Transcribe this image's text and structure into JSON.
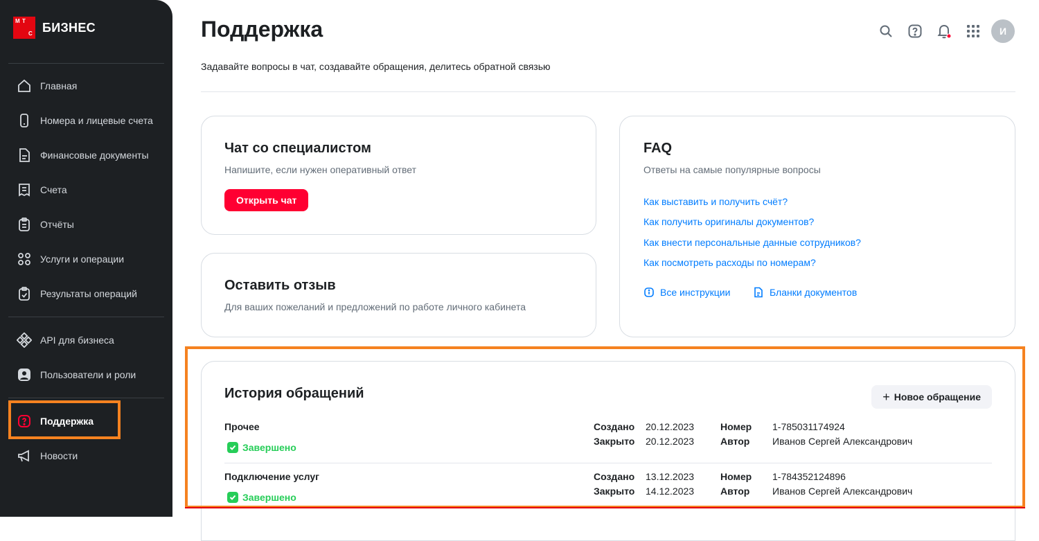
{
  "brand": {
    "logo_letters": [
      "М",
      "Т",
      "С"
    ],
    "name": "БИЗНЕС",
    "color": "#e30611"
  },
  "sidebar": {
    "items": [
      {
        "label": "Главная",
        "icon": "home-icon"
      },
      {
        "label": "Номера и лицевые счета",
        "icon": "phone-icon"
      },
      {
        "label": "Финансовые документы",
        "icon": "document-icon"
      },
      {
        "label": "Счета",
        "icon": "receipt-icon"
      },
      {
        "label": "Отчёты",
        "icon": "clipboard-icon"
      },
      {
        "label": "Услуги и операции",
        "icon": "grid-icon"
      },
      {
        "label": "Результаты операций",
        "icon": "clipboard-check-icon"
      },
      {
        "label": "API для бизнеса",
        "icon": "api-icon"
      },
      {
        "label": "Пользователи и роли",
        "icon": "user-badge-icon"
      },
      {
        "label": "Поддержка",
        "icon": "support-icon",
        "active": true
      },
      {
        "label": "Новости",
        "icon": "megaphone-icon"
      }
    ]
  },
  "header": {
    "title": "Поддержка",
    "subtitle": "Задавайте вопросы в чат, создавайте обращения, делитесь обратной связью",
    "avatar_letter": "И",
    "icons": [
      "search-icon",
      "help-icon",
      "bell-icon",
      "apps-icon"
    ]
  },
  "chat_card": {
    "title": "Чат со специалистом",
    "subtitle": "Напишите, если нужен оперативный ответ",
    "button": "Открыть чат"
  },
  "feedback_card": {
    "title": "Оставить отзыв",
    "subtitle": "Для ваших пожеланий и предложений по работе личного кабинета"
  },
  "faq_card": {
    "title": "FAQ",
    "subtitle": "Ответы на самые популярные вопросы",
    "links": [
      "Как выставить и получить счёт?",
      "Как получить оригиналы документов?",
      "Как внести персональные данные сотрудников?",
      "Как посмотреть расходы по номерам?"
    ],
    "all_instructions": "Все инструкции",
    "doc_forms": "Бланки документов"
  },
  "history": {
    "title": "История обращений",
    "new_button": "Новое обращение",
    "labels": {
      "created": "Создано",
      "closed": "Закрыто",
      "number": "Номер",
      "author": "Автор"
    },
    "rows": [
      {
        "title": "Прочее",
        "status": "Завершено",
        "created": "20.12.2023",
        "closed": "20.12.2023",
        "number": "1-785031174924",
        "author": "Иванов Сергей Александрович"
      },
      {
        "title": "Подключение услуг",
        "status": "Завершено",
        "created": "13.12.2023",
        "closed": "14.12.2023",
        "number": "1-784352124896",
        "author": "Иванов Сергей Александрович"
      }
    ]
  },
  "colors": {
    "accent_red": "#ff0032",
    "link_blue": "#007cff",
    "success_green": "#26cd58",
    "highlight_orange": "#f58220"
  }
}
